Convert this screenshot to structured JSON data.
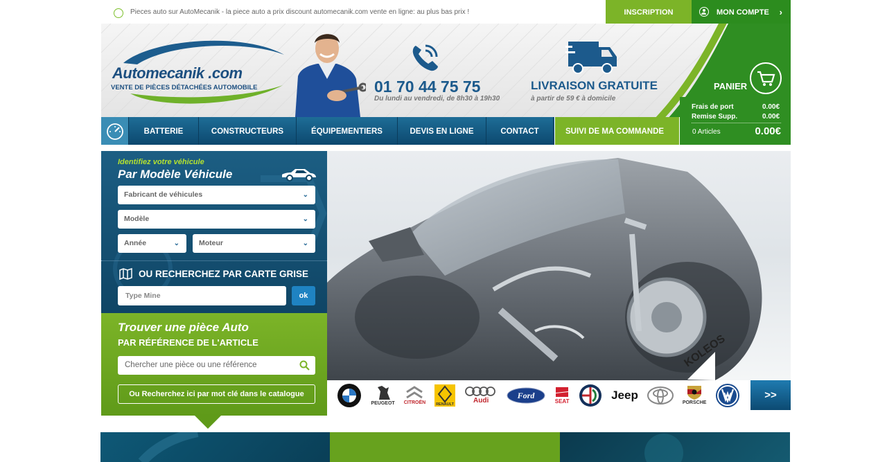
{
  "topbar": {
    "tagline": "Pieces auto sur AutoMecanik - la piece auto a prix discount automecanik.com vente en ligne: au plus bas prix !",
    "inscription": "INSCRIPTION",
    "mon_compte": "MON COMPTE"
  },
  "header": {
    "logo_text": "Automecanik .com",
    "logo_sub": "VENTE DE PIÈCES DÉTACHÉES AUTOMOBILE",
    "phone": "01 70 44 75 75",
    "hours": "Du lundi au vendredi, de 8h30 à 19h30",
    "livraison": "LIVRAISON GRATUITE",
    "livraison_sub": "à partir de 59 € à domicile",
    "panier": "PANIER"
  },
  "cart": {
    "frais_label": "Frais de port",
    "frais_value": "0.00€",
    "remise_label": "Remise Supp.",
    "remise_value": "0.00€",
    "articles": "0 Articles",
    "total": "0.00€"
  },
  "nav": {
    "items": [
      "BATTERIE",
      "CONSTRUCTEURS",
      "ÉQUIPEMENTIERS",
      "DEVIS EN LIGNE",
      "CONTACT"
    ],
    "suivi": "SUIVI DE MA COMMANDE"
  },
  "vehicle_search": {
    "small_title": "Identifiez votre véhicule",
    "big_title": "Par Modèle Véhicule",
    "fabricant": "Fabricant de véhicules",
    "modele": "Modèle",
    "annee": "Année",
    "moteur": "Moteur",
    "carte_title": "OU RECHERCHEZ PAR CARTE GRISE",
    "typemine_placeholder": "Type Mine",
    "ok": "ok"
  },
  "part_search": {
    "title": "Trouver une pièce Auto",
    "subtitle": "PAR RÉFÉRENCE DE L'ARTICLE",
    "placeholder": "Chercher une pièce ou une référence",
    "catalogue": "Ou Recherchez ici par mot clé dans le catalogue"
  },
  "hero": {
    "plate": "KOLEOS"
  },
  "brands": {
    "items": [
      "BMW",
      "PEUGEOT",
      "CITROËN",
      "RENAULT",
      "Audi",
      "Ford",
      "SEAT",
      "ALFA ROMEO",
      "Jeep",
      "TOYOTA",
      "PORSCHE",
      "VW"
    ],
    "next": ">>"
  },
  "colors": {
    "blue_dark": "#0c486f",
    "blue": "#1c5a8c",
    "green_light": "#7cb428",
    "green_dark": "#2f8e22",
    "lime_text": "#b5e22f"
  }
}
